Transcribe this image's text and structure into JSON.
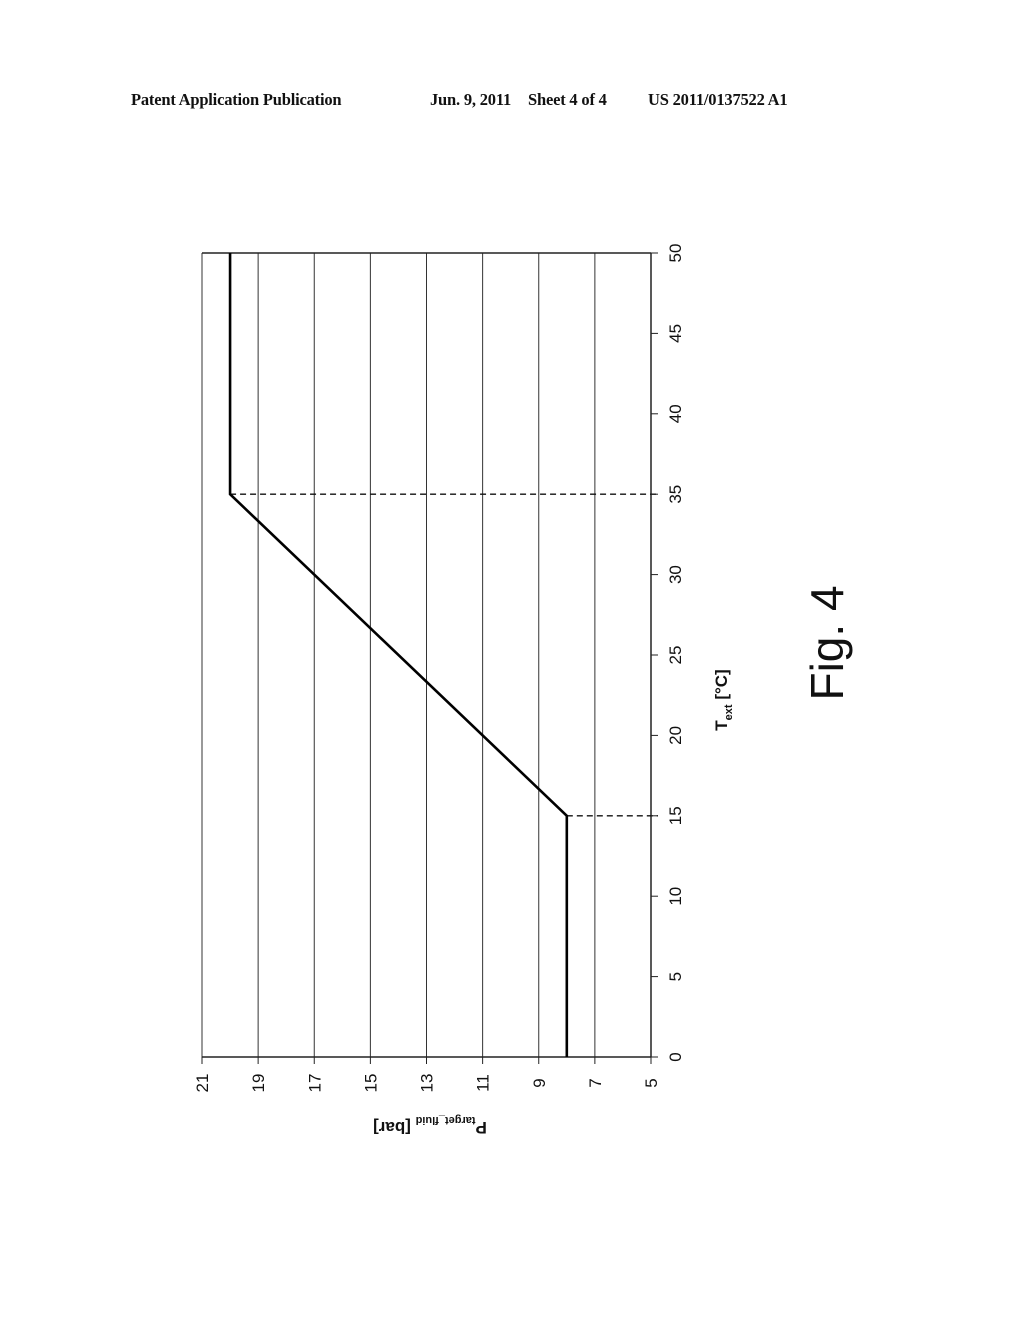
{
  "header": {
    "publication": "Patent Application Publication",
    "date": "Jun. 9, 2011",
    "sheet": "Sheet 4 of 4",
    "number": "US 2011/0137522 A1"
  },
  "figure": {
    "label": "Fig. 4"
  },
  "chart_data": {
    "type": "line",
    "orientation": "rotated 90° clockwise on page",
    "title": "",
    "xlabel": "T_ext [°C]",
    "xlabel_main": "T",
    "xlabel_sub": "ext",
    "xlabel_unit": " [°C]",
    "ylabel": "P_target_fluid [bar]",
    "ylabel_main": "P",
    "ylabel_sub": "target_fluid",
    "ylabel_unit": " [bar]",
    "xlim": [
      0,
      50
    ],
    "ylim": [
      5,
      21
    ],
    "x_ticks": [
      0,
      5,
      10,
      15,
      20,
      25,
      30,
      35,
      40,
      45,
      50
    ],
    "y_ticks": [
      21,
      19,
      17,
      15,
      13,
      11,
      9,
      7,
      5
    ],
    "grid": "horizontal gridlines at each y tick",
    "series": [
      {
        "name": "P_target_fluid",
        "style": "solid-bold",
        "x": [
          0,
          15,
          35,
          50
        ],
        "y": [
          8,
          8,
          20,
          20
        ]
      }
    ],
    "reference_lines": [
      {
        "name": "T=15 marker",
        "style": "dashed",
        "x": 15,
        "y_from": 8,
        "y_to": 5
      },
      {
        "name": "T=35 marker",
        "style": "dashed",
        "x": 35,
        "y_from": 20,
        "y_to": 5
      }
    ],
    "legend": "none"
  }
}
